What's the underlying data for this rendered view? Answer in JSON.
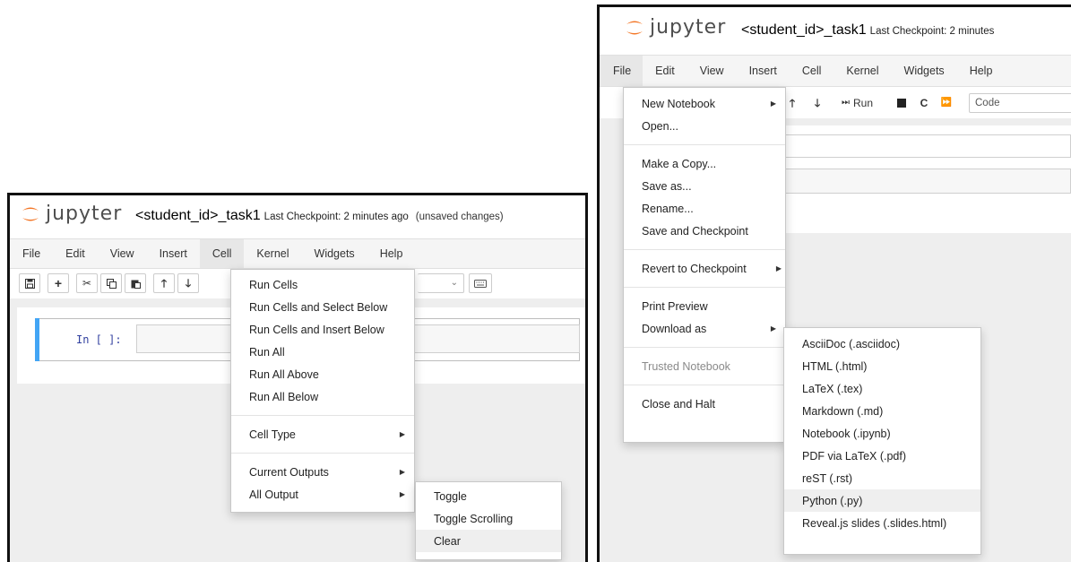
{
  "left": {
    "logo_text": "jupyter",
    "notebook_name": "<student_id>_task1",
    "checkpoint": "Last Checkpoint: 2 minutes ago",
    "unsaved": "(unsaved changes)",
    "menu": [
      "File",
      "Edit",
      "View",
      "Insert",
      "Cell",
      "Kernel",
      "Widgets",
      "Help"
    ],
    "open_menu": "Cell",
    "cell_prompt": "In [ ]:",
    "cell_menu": {
      "group1": [
        "Run Cells",
        "Run Cells and Select Below",
        "Run Cells and Insert Below",
        "Run All",
        "Run All Above",
        "Run All Below"
      ],
      "cell_type": "Cell Type",
      "current_outputs": "Current Outputs",
      "all_output": "All Output"
    },
    "all_output_submenu": [
      "Toggle",
      "Toggle Scrolling",
      "Clear"
    ],
    "highlighted_submenu_item": "Clear"
  },
  "right": {
    "logo_text": "jupyter",
    "notebook_name": "<student_id>_task1",
    "checkpoint": "Last Checkpoint: 2 minutes",
    "menu": [
      "File",
      "Edit",
      "View",
      "Insert",
      "Cell",
      "Kernel",
      "Widgets",
      "Help"
    ],
    "open_menu": "File",
    "toolbar": {
      "run_label": "Run",
      "cell_type_value": "Code"
    },
    "file_menu": {
      "new_notebook": "New Notebook",
      "open": "Open...",
      "make_copy": "Make a Copy...",
      "save_as": "Save as...",
      "rename": "Rename...",
      "save_checkpoint": "Save and Checkpoint",
      "revert": "Revert to Checkpoint",
      "print_preview": "Print Preview",
      "download_as": "Download as",
      "trusted": "Trusted Notebook",
      "close_halt": "Close and Halt"
    },
    "download_submenu": [
      "AsciiDoc (.asciidoc)",
      "HTML (.html)",
      "LaTeX (.tex)",
      "Markdown (.md)",
      "Notebook (.ipynb)",
      "PDF via LaTeX (.pdf)",
      "reST (.rst)",
      "Python (.py)",
      "Reveal.js slides (.slides.html)"
    ],
    "highlighted_download_item": "Python (.py)"
  },
  "colors": {
    "jupyter_orange": "#f37626",
    "cell_selected_bar": "#42a5f5",
    "prompt_blue": "#303f9f"
  },
  "icons": [
    "save-icon",
    "plus-icon",
    "scissors-icon",
    "copy-icon",
    "paste-icon",
    "arrow-up-icon",
    "arrow-down-icon",
    "run-icon",
    "stop-icon",
    "restart-icon",
    "fast-forward-icon",
    "keyboard-icon",
    "chevron-down-icon",
    "caret-right-icon"
  ]
}
